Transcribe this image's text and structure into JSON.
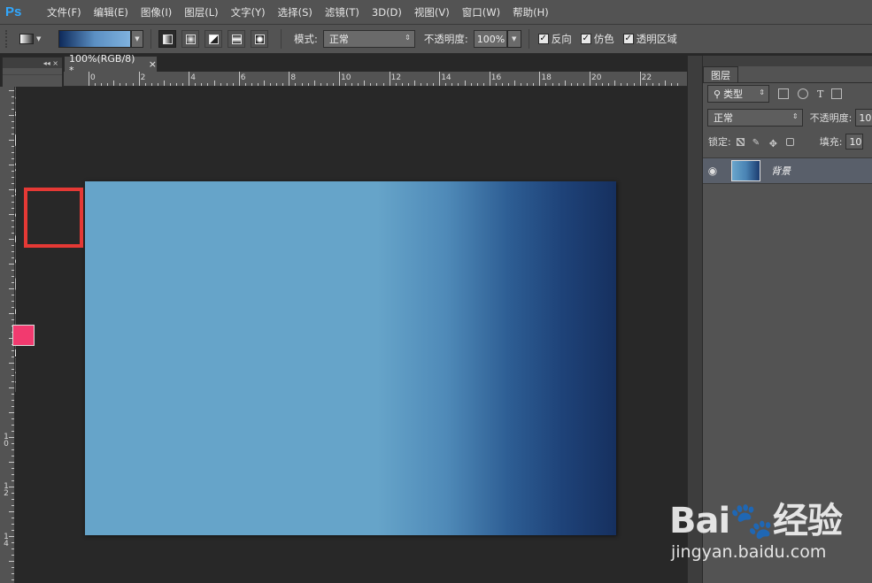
{
  "app": {
    "logo": "Ps"
  },
  "menu": [
    {
      "label": "文件(F)"
    },
    {
      "label": "编辑(E)"
    },
    {
      "label": "图像(I)"
    },
    {
      "label": "图层(L)"
    },
    {
      "label": "文字(Y)"
    },
    {
      "label": "选择(S)"
    },
    {
      "label": "滤镜(T)"
    },
    {
      "label": "3D(D)"
    },
    {
      "label": "视图(V)"
    },
    {
      "label": "窗口(W)"
    },
    {
      "label": "帮助(H)"
    }
  ],
  "options": {
    "mode_label": "模式:",
    "mode_value": "正常",
    "opacity_label": "不透明度:",
    "opacity_value": "100%",
    "reverse_label": "反向",
    "dither_label": "仿色",
    "transparency_label": "透明区域",
    "reverse_checked": true,
    "dither_checked": true,
    "transparency_checked": true,
    "gradient_types": [
      "linear-gradient-icon",
      "radial-gradient-icon",
      "angle-gradient-icon",
      "reflected-gradient-icon",
      "diamond-gradient-icon"
    ],
    "active_gradient_type": "linear-gradient-icon"
  },
  "document": {
    "tab_title": "100%(RGB/8) *",
    "close_glyph": "×"
  },
  "ruler": {
    "top_labels": [
      "0",
      "2",
      "4",
      "6",
      "8",
      "10",
      "12",
      "14",
      "16",
      "18",
      "20",
      "22"
    ],
    "left_labels": [
      "1\n0",
      "1\n2",
      "1\n4"
    ]
  },
  "tools": {
    "selected": "gradient-tool",
    "foreground_color": "#f23a6f",
    "background_color": "#ffffff",
    "panel_controls": "◂◂  ×"
  },
  "layers_panel": {
    "tab_label": "图层",
    "filter_label": "类型",
    "blend_mode": "正常",
    "opacity_label": "不透明度:",
    "opacity_value": "10",
    "lock_label": "锁定:",
    "fill_label": "填充:",
    "fill_value": "10",
    "layers": [
      {
        "name": "背景",
        "visible": true
      }
    ]
  },
  "canvas": {
    "gradient_colors": [
      "#66a4c9",
      "#4f8ab8",
      "#2d5d93",
      "#16305f"
    ]
  },
  "watermark": {
    "brand": "Bai🐾经验",
    "url": "jingyan.baidu.com"
  }
}
